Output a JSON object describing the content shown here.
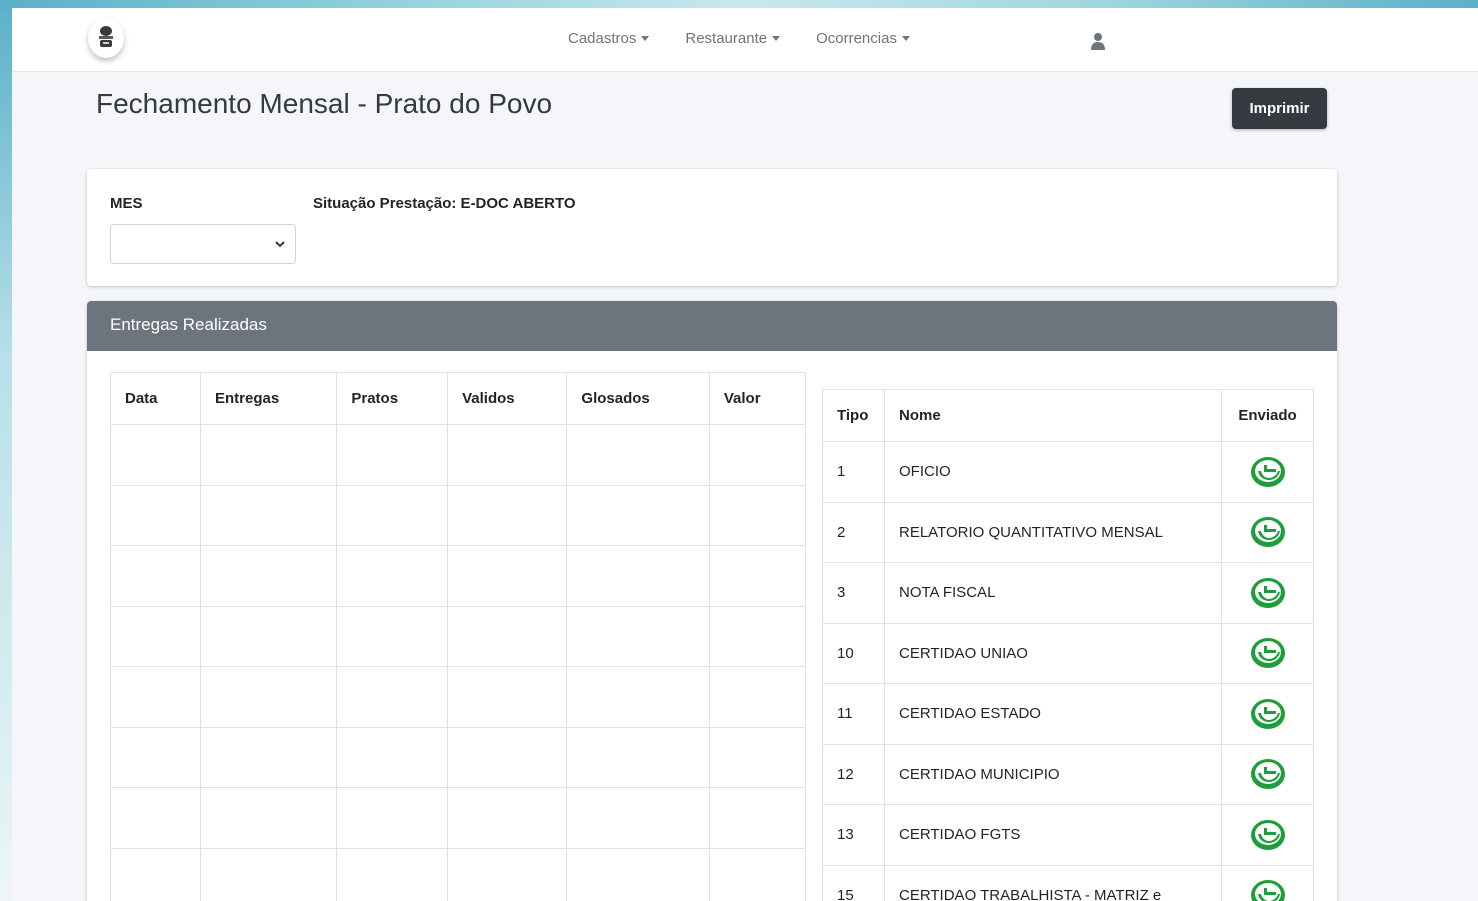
{
  "nav": {
    "items": [
      {
        "label": "Cadastros"
      },
      {
        "label": "Restaurante"
      },
      {
        "label": "Ocorrencias"
      }
    ]
  },
  "page": {
    "title": "Fechamento Mensal - Prato do Povo",
    "print_label": "Imprimir"
  },
  "filter": {
    "mes_label": "MES",
    "mes_value": "",
    "situacao": "Situação Prestação: E-DOC ABERTO"
  },
  "entregas": {
    "header": "Entregas Realizadas",
    "columns": [
      "Data",
      "Entregas",
      "Pratos",
      "Validos",
      "Glosados",
      "Valor"
    ],
    "rows": [
      [
        "",
        "",
        "",
        "",
        "",
        ""
      ],
      [
        "",
        "",
        "",
        "",
        "",
        ""
      ],
      [
        "",
        "",
        "",
        "",
        "",
        ""
      ],
      [
        "",
        "",
        "",
        "",
        "",
        ""
      ],
      [
        "",
        "",
        "",
        "",
        "",
        ""
      ],
      [
        "",
        "",
        "",
        "",
        "",
        ""
      ],
      [
        "",
        "",
        "",
        "",
        "",
        ""
      ],
      [
        "",
        "",
        "",
        "",
        "",
        ""
      ]
    ]
  },
  "documentos": {
    "columns": [
      "Tipo",
      "Nome",
      "Enviado"
    ],
    "rows": [
      {
        "tipo": "1",
        "nome": "OFICIO"
      },
      {
        "tipo": "2",
        "nome": "RELATORIO QUANTITATIVO MENSAL"
      },
      {
        "tipo": "3",
        "nome": "NOTA FISCAL"
      },
      {
        "tipo": "10",
        "nome": "CERTIDAO UNIAO"
      },
      {
        "tipo": "11",
        "nome": "CERTIDAO ESTADO"
      },
      {
        "tipo": "12",
        "nome": "CERTIDAO MUNICIPIO"
      },
      {
        "tipo": "13",
        "nome": "CERTIDAO FGTS"
      },
      {
        "tipo": "15",
        "nome": "CERTIDAO TRABALHISTA - MATRIZ e"
      }
    ],
    "sent_icon": "check-circle-icon",
    "sent_color": "#1e9e3a"
  },
  "colors": {
    "card_header": "#6c757d",
    "button": "#343a40"
  }
}
